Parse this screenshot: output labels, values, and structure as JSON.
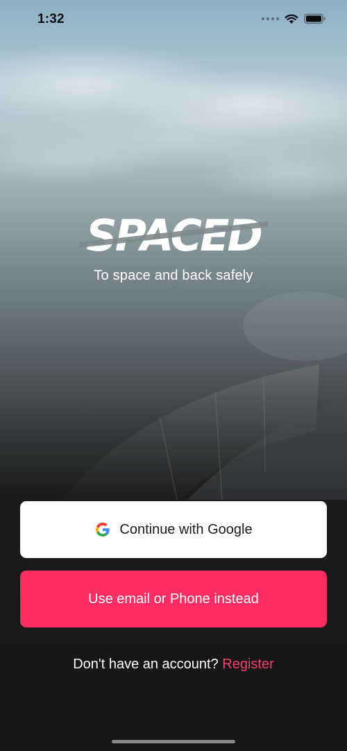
{
  "status_bar": {
    "time": "1:32",
    "icons": [
      "signal-dots-icon",
      "wifi-icon",
      "battery-icon"
    ]
  },
  "brand": {
    "logo_text": "SPACED",
    "tagline": "To space and back safely"
  },
  "actions": {
    "google_label": "Continue with Google",
    "email_label": "Use email or Phone instead"
  },
  "register": {
    "prompt": "Don't have an account?",
    "link_label": "Register"
  },
  "colors": {
    "accent": "#fc2d62",
    "link": "#f2426e",
    "background": "#151515",
    "button_light": "#ffffff"
  }
}
